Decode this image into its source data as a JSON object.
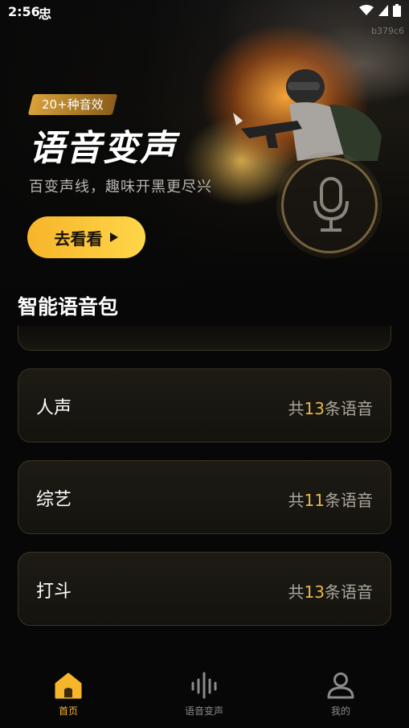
{
  "status_bar": {
    "time": "2:56",
    "carrier_icon": "忠",
    "icons": [
      "wifi-icon",
      "signal-icon",
      "battery-icon"
    ]
  },
  "watermark": "b379c6",
  "hero": {
    "badge": "20+种音效",
    "title": "语音变声",
    "subtitle": "百变声线，趣味开黑更尽兴",
    "cta_label": "去看看"
  },
  "section": {
    "title": "智能语音包"
  },
  "cards": [
    {
      "name": "人声",
      "prefix": "共",
      "count": "13",
      "suffix": "条语音"
    },
    {
      "name": "综艺",
      "prefix": "共",
      "count": "11",
      "suffix": "条语音"
    },
    {
      "name": "打斗",
      "prefix": "共",
      "count": "13",
      "suffix": "条语音"
    }
  ],
  "nav": [
    {
      "label": "首页",
      "icon": "home-icon",
      "active": true
    },
    {
      "label": "语音变声",
      "icon": "voice-wave-icon",
      "active": false
    },
    {
      "label": "我的",
      "icon": "user-icon",
      "active": false
    }
  ],
  "colors": {
    "accent": "#f6b52a",
    "count_highlight": "#e9b84a",
    "background": "#070707"
  }
}
